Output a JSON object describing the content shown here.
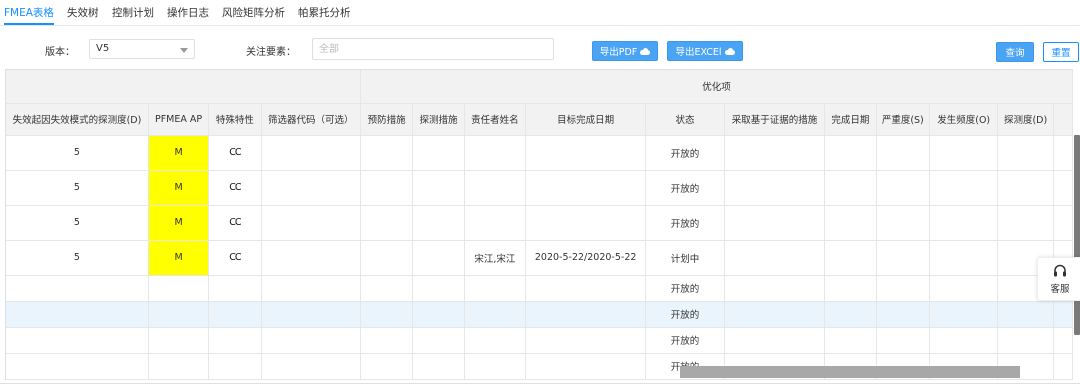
{
  "tabs": [
    {
      "label": "FMEA表格",
      "active": true
    },
    {
      "label": "失效树",
      "active": false
    },
    {
      "label": "控制计划",
      "active": false
    },
    {
      "label": "操作日志",
      "active": false
    },
    {
      "label": "风险矩阵分析",
      "active": false
    },
    {
      "label": "帕累托分析",
      "active": false
    }
  ],
  "filters": {
    "version_label": "版本：",
    "version_value": "V5",
    "focus_label": "关注要素：",
    "focus_placeholder": "全部"
  },
  "buttons": {
    "export_pdf": "导出PDF",
    "export_excel": "导出EXCEl",
    "query": "查询",
    "reset": "重置"
  },
  "table": {
    "group_header": "优化项",
    "columns": [
      "失效起因失效模式的探测度(D)",
      "PFMEA AP",
      "特殊特性",
      "筛选器代码（可选）",
      "预防措施",
      "探测措施",
      "责任者姓名",
      "目标完成日期",
      "状态",
      "采取基于证据的措施",
      "完成日期",
      "严重度(S)",
      "发生频度(O)",
      "探测度(D)"
    ],
    "rows": [
      {
        "d": "5",
        "ap": "M",
        "special": "CC",
        "filter": "",
        "prevent": "",
        "detect": "",
        "owner": "",
        "target": "",
        "status": "开放的",
        "evidence": "",
        "done": "",
        "s": "",
        "o": "",
        "d2": ""
      },
      {
        "d": "5",
        "ap": "M",
        "special": "CC",
        "filter": "",
        "prevent": "",
        "detect": "",
        "owner": "",
        "target": "",
        "status": "开放的",
        "evidence": "",
        "done": "",
        "s": "",
        "o": "",
        "d2": ""
      },
      {
        "d": "5",
        "ap": "M",
        "special": "CC",
        "filter": "",
        "prevent": "",
        "detect": "",
        "owner": "",
        "target": "",
        "status": "开放的",
        "evidence": "",
        "done": "",
        "s": "",
        "o": "",
        "d2": ""
      },
      {
        "d": "5",
        "ap": "M",
        "special": "CC",
        "filter": "",
        "prevent": "",
        "detect": "",
        "owner": "宋江,宋江",
        "target": "2020-5-22/2020-5-22",
        "status": "计划中",
        "evidence": "",
        "done": "",
        "s": "",
        "o": "",
        "d2": ""
      },
      {
        "d": "",
        "ap": "",
        "special": "",
        "filter": "",
        "prevent": "",
        "detect": "",
        "owner": "",
        "target": "",
        "status": "开放的",
        "evidence": "",
        "done": "",
        "s": "",
        "o": "",
        "d2": ""
      },
      {
        "d": "",
        "ap": "",
        "special": "",
        "filter": "",
        "prevent": "",
        "detect": "",
        "owner": "",
        "target": "",
        "status": "开放的",
        "evidence": "",
        "done": "",
        "s": "",
        "o": "",
        "d2": ""
      },
      {
        "d": "",
        "ap": "",
        "special": "",
        "filter": "",
        "prevent": "",
        "detect": "",
        "owner": "",
        "target": "",
        "status": "开放的",
        "evidence": "",
        "done": "",
        "s": "",
        "o": "",
        "d2": ""
      },
      {
        "d": "",
        "ap": "",
        "special": "",
        "filter": "",
        "prevent": "",
        "detect": "",
        "owner": "",
        "target": "",
        "status": "开放的",
        "evidence": "",
        "done": "",
        "s": "",
        "o": "",
        "d2": ""
      }
    ]
  },
  "support": {
    "label": "客服",
    "icon": "headset-icon"
  },
  "colors": {
    "accent": "#1890ff",
    "ap_medium": "#ffff00",
    "highlight_row": "#eaf4fd"
  }
}
